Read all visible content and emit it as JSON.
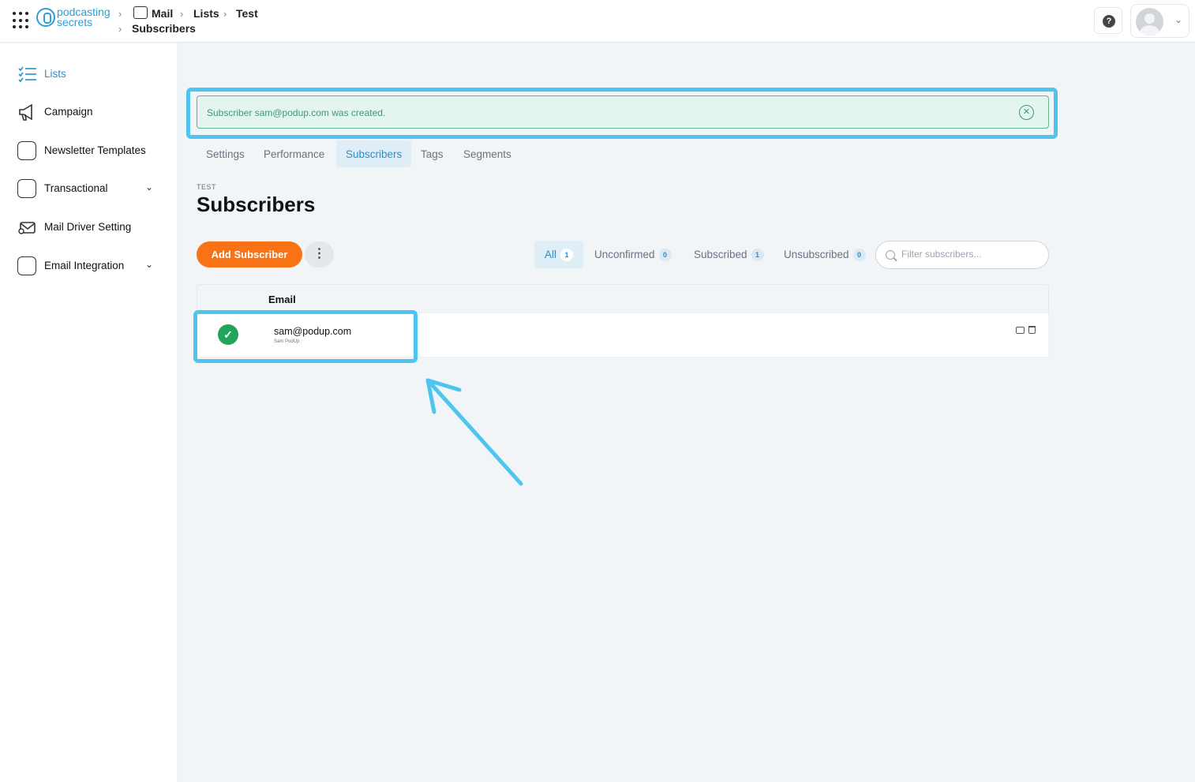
{
  "brand": {
    "line1": "podcasting",
    "line2": "secrets"
  },
  "breadcrumb": {
    "mail": "Mail",
    "lists": "Lists",
    "test": "Test",
    "subscribers": "Subscribers"
  },
  "header": {
    "help_glyph": "?"
  },
  "sidebar": {
    "items": [
      {
        "label": "Lists",
        "icon": "list-check-icon",
        "active": true
      },
      {
        "label": "Campaign",
        "icon": "megaphone-icon"
      },
      {
        "label": "Newsletter Templates",
        "icon": "newsletter-icon"
      },
      {
        "label": "Transactional",
        "icon": "inbox-icon",
        "expandable": true
      },
      {
        "label": "Mail Driver Setting",
        "icon": "mail-settings-icon"
      },
      {
        "label": "Email Integration",
        "icon": "inbox-icon",
        "expandable": true
      }
    ]
  },
  "alert": {
    "text": "Subscriber sam@podup.com was created.",
    "close_glyph": "✕"
  },
  "tabs": [
    "Settings",
    "Performance",
    "Subscribers",
    "Tags",
    "Segments"
  ],
  "active_tab": "Subscribers",
  "page": {
    "eyebrow": "TEST",
    "title": "Subscribers"
  },
  "toolbar": {
    "add_label": "Add Subscriber",
    "more_glyph": "⋮"
  },
  "filters": [
    {
      "label": "All",
      "count": "1",
      "active": true
    },
    {
      "label": "Unconfirmed",
      "count": "0"
    },
    {
      "label": "Subscribed",
      "count": "1"
    },
    {
      "label": "Unsubscribed",
      "count": "0"
    }
  ],
  "search": {
    "placeholder": "Filter subscribers...",
    "value": ""
  },
  "table": {
    "columns": [
      "Email"
    ],
    "rows": [
      {
        "email": "sam@podup.com",
        "name": "Sam PodUp",
        "status": "subscribed"
      }
    ]
  },
  "colors": {
    "accent": "#2a8fc9",
    "primary_button": "#f97316",
    "success": "#22a55b",
    "annotation": "#4ec5ef"
  }
}
